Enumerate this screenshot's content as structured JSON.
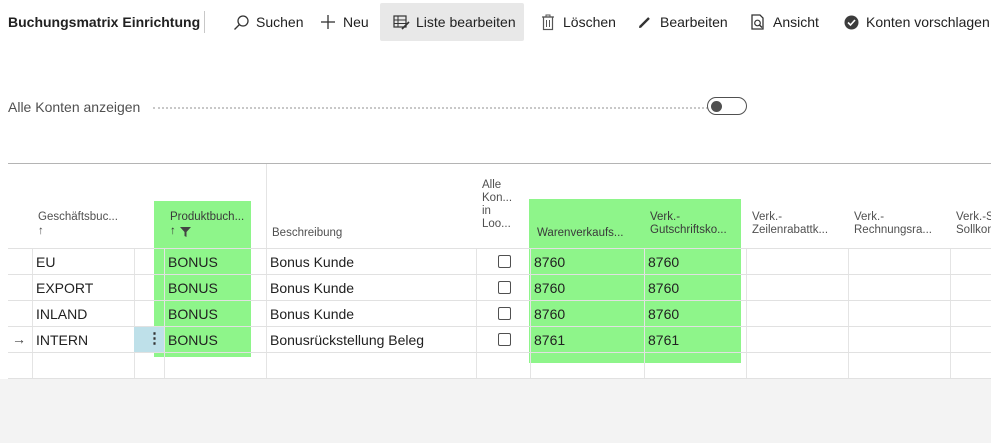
{
  "toolbar": {
    "title": "Buchungsmatrix Einrichtung",
    "buttons": [
      {
        "label": "Suchen",
        "icon": "search-icon"
      },
      {
        "label": "Neu",
        "icon": "plus-icon"
      },
      {
        "label": "Liste bearbeiten",
        "icon": "edit-list-icon"
      },
      {
        "label": "Löschen",
        "icon": "trash-icon"
      },
      {
        "label": "Bearbeiten",
        "icon": "pencil-icon"
      },
      {
        "label": "Ansicht",
        "icon": "view-icon"
      },
      {
        "label": "Konten vorschlagen",
        "icon": "check-circle-icon"
      }
    ]
  },
  "filter": {
    "show_all_label": "Alle Konten anzeigen",
    "show_all_value": false
  },
  "table": {
    "headers": {
      "col1": "Geschäftsbuc...",
      "col1_sort": "↑",
      "col2": "Produktbuch...",
      "col2_sort": "↑",
      "col3": "Beschreibung",
      "col4_lines": [
        "Alle",
        "Kon...",
        "in",
        "Loo..."
      ],
      "col5": "Warenverkaufs...",
      "col6_line1": "Verk.-",
      "col6_line2": "Gutschriftsko...",
      "col7_line1": "Verk.-",
      "col7_line2": "Zeilenrabattk...",
      "col8_line1": "Verk.-",
      "col8_line2": "Rechnungsra...",
      "col9_line1": "Verk.-S",
      "col9_line2": "Sollkon"
    },
    "rows": [
      {
        "bus": "EU",
        "prod": "BONUS",
        "desc": "Bonus Kunde",
        "sales": "8760",
        "credit": "8760"
      },
      {
        "bus": "EXPORT",
        "prod": "BONUS",
        "desc": "Bonus Kunde",
        "sales": "8760",
        "credit": "8760"
      },
      {
        "bus": "INLAND",
        "prod": "BONUS",
        "desc": "Bonus Kunde",
        "sales": "8760",
        "credit": "8760"
      },
      {
        "bus": "INTERN",
        "prod": "BONUS",
        "desc": "Bonusrückstellung Beleg",
        "sales": "8761",
        "credit": "8761"
      }
    ],
    "current_row_marker": "→",
    "row_menu": "⋮"
  },
  "colors": {
    "highlight": "#8ef58a",
    "selected_cell": "#bee0e9",
    "toolbar_active": "#e8e8e8"
  }
}
